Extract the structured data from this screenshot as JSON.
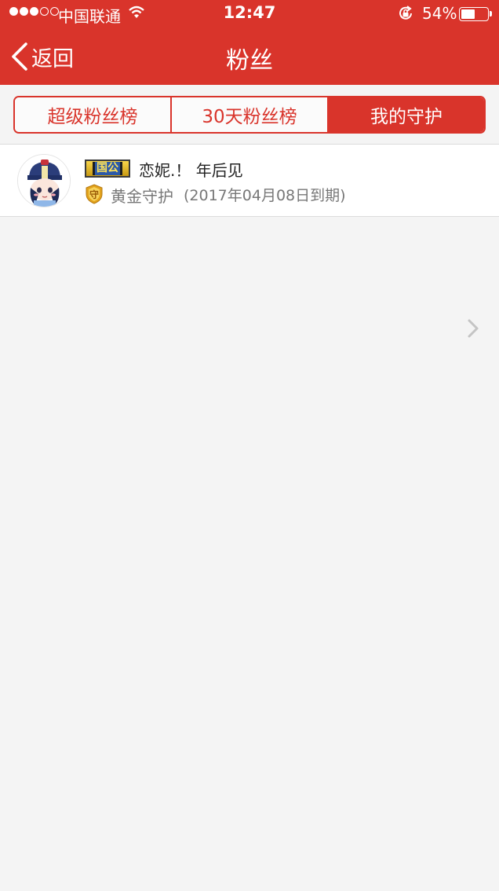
{
  "status_bar": {
    "carrier": "中国联通",
    "time": "12:47",
    "battery_percent": "54%",
    "battery_level": 0.54,
    "signal_bars_filled": 3,
    "signal_bars_total": 5
  },
  "nav": {
    "back_label": "返回",
    "title": "粉丝"
  },
  "tabs": [
    {
      "label": "超级粉丝榜",
      "active": false
    },
    {
      "label": "30天粉丝榜",
      "active": false
    },
    {
      "label": "我的守护",
      "active": true
    }
  ],
  "guard_list": [
    {
      "rank_badge": "国公",
      "nickname": "恋妮.！ 年后见",
      "shield_glyph": "守",
      "guard_type": "黄金守护",
      "expire": "(2017年04月08日到期)"
    }
  ],
  "colors": {
    "accent": "#d9342b",
    "background": "#f4f4f4",
    "badge_gold": "#e2b52a",
    "text_secondary": "#777777"
  },
  "icons": [
    "back-chevron-icon",
    "wifi-icon",
    "orientation-lock-icon",
    "battery-icon",
    "gold-shield-icon",
    "chevron-right-icon"
  ]
}
